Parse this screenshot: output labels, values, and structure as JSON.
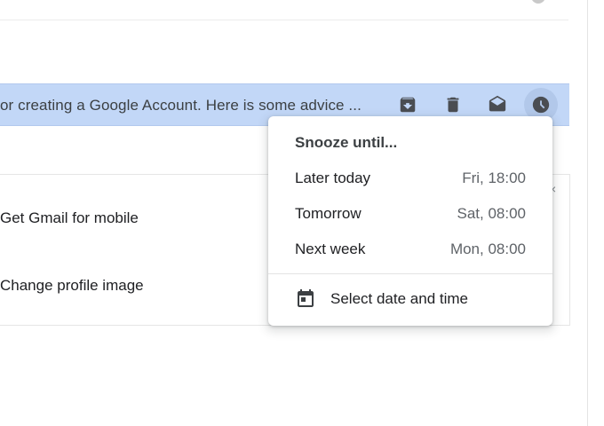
{
  "email_row": {
    "snippet": "or creating a Google Account. Here is some advice ..."
  },
  "row_actions": [
    {
      "name": "archive",
      "icon": "archive-icon"
    },
    {
      "name": "delete",
      "icon": "trash-icon"
    },
    {
      "name": "mark-as-read",
      "icon": "envelope-open-icon"
    },
    {
      "name": "snooze",
      "icon": "clock-icon"
    }
  ],
  "tips": {
    "item1": "Get Gmail for mobile",
    "item2": "Change profile image",
    "close": "×"
  },
  "snooze_menu": {
    "title": "Snooze until...",
    "options": [
      {
        "label": "Later today",
        "time": "Fri, 18:00"
      },
      {
        "label": "Tomorrow",
        "time": "Sat, 08:00"
      },
      {
        "label": "Next week",
        "time": "Mon, 08:00"
      }
    ],
    "pick_label": "Select date and time"
  },
  "colors": {
    "selected_row": "#c2d7f7",
    "snooze_hover": "#b2c8ea"
  }
}
